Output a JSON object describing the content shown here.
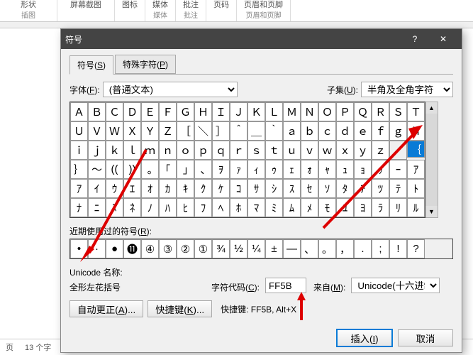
{
  "ribbon": [
    "形状",
    "屏幕截图",
    "图标",
    "媒体",
    "批注",
    "页码",
    "页眉和页脚"
  ],
  "ribbonGroups": [
    "插图",
    "",
    "",
    "媒体",
    "批注",
    "页眉和页脚"
  ],
  "status": {
    "page": "页",
    "words": "13 个字",
    "lang": ""
  },
  "dialog": {
    "title": "符号",
    "tabs": {
      "sym_pre": "符号(",
      "sym_u": "S",
      "sym_post": ")",
      "spec_pre": "特殊字符(",
      "spec_u": "P",
      "spec_post": ")"
    },
    "fontLabel_pre": "字体(",
    "fontLabel_u": "F",
    "fontLabel_post": "):",
    "fontValue": "(普通文本)",
    "subsetLabel_pre": "子集(",
    "subsetLabel_u": "U",
    "subsetLabel_post": "):",
    "subsetValue": "半角及全角字符",
    "grid": [
      [
        "Ａ",
        "Ｂ",
        "Ｃ",
        "Ｄ",
        "Ｅ",
        "Ｆ",
        "Ｇ",
        "Ｈ",
        "Ｉ",
        "Ｊ",
        "Ｋ",
        "Ｌ",
        "Ｍ",
        "Ｎ",
        "Ｏ",
        "Ｐ",
        "Ｑ",
        "Ｒ",
        "Ｓ",
        "Ｔ"
      ],
      [
        "Ｕ",
        "Ｖ",
        "Ｗ",
        "Ｘ",
        "Ｙ",
        "Ｚ",
        "［",
        "＼",
        "］",
        "＾",
        "＿",
        "｀",
        "ａ",
        "ｂ",
        "ｃ",
        "ｄ",
        "ｅ",
        "ｆ",
        "ｇ",
        "ｈ"
      ],
      [
        "ｉ",
        "ｊ",
        "ｋ",
        "ｌ",
        "ｍ",
        "ｎ",
        "ｏ",
        "ｐ",
        "ｑ",
        "ｒ",
        "ｓ",
        "ｔ",
        "ｕ",
        "ｖ",
        "ｗ",
        "ｘ",
        "ｙ",
        "ｚ",
        "",
        "｛"
      ],
      [
        "｝",
        "～",
        "((",
        "))",
        "｡",
        "｢",
        "｣",
        "､",
        "ｦ",
        "ｧ",
        "ｨ",
        "ｩ",
        "ｪ",
        "ｫ",
        "ｬ",
        "ｭ",
        "ｮ",
        "ｯ",
        "ｰ",
        "ｱ"
      ],
      [
        "ｱ",
        "ｲ",
        "ｳ",
        "ｴ",
        "ｵ",
        "ｶ",
        "ｷ",
        "ｸ",
        "ｹ",
        "ｺ",
        "ｻ",
        "ｼ",
        "ｽ",
        "ｾ",
        "ｿ",
        "ﾀ",
        "ﾁ",
        "ﾂ",
        "ﾃ",
        "ﾄ"
      ],
      [
        "ﾅ",
        "ﾆ",
        "ﾇ",
        "ﾈ",
        "ﾉ",
        "ﾊ",
        "ﾋ",
        "ﾌ",
        "ﾍ",
        "ﾎ",
        "ﾏ",
        "ﾐ",
        "ﾑ",
        "ﾒ",
        "ﾓ",
        "ﾕ",
        "ﾖ",
        "ﾗ",
        "ﾘ",
        "ﾙ"
      ]
    ],
    "selected": {
      "row": 2,
      "col": 19
    },
    "emptyCell": {
      "row": 2,
      "col": 18
    },
    "recentLabel_pre": "近期使用过的符号(",
    "recentLabel_u": "R",
    "recentLabel_post": "):",
    "recent": [
      "•",
      "·",
      "●",
      "⓫",
      "④",
      "③",
      "②",
      "①",
      "¾",
      "½",
      "¼",
      "±",
      "—",
      "、",
      "。",
      "，",
      ".",
      ";",
      "!",
      "?"
    ],
    "unicodeNameLabel": "Unicode 名称:",
    "unicodeName": "全形左花括号",
    "codeLabel_pre": "字符代码(",
    "codeLabel_u": "C",
    "codeLabel_post": "):",
    "codeValue": "FF5B",
    "fromLabel_pre": "来自(",
    "fromLabel_u": "M",
    "fromLabel_post": "):",
    "fromValue": "Unicode(十六进制)",
    "autocorrect_pre": "自动更正(",
    "autocorrect_u": "A",
    "autocorrect_post": ")...",
    "shortcut_pre": "快捷键(",
    "shortcut_u": "K",
    "shortcut_post": ")...",
    "shortcutText": "快捷键: FF5B, Alt+X",
    "insert_pre": "插入(",
    "insert_u": "I",
    "insert_post": ")",
    "cancel": "取消"
  }
}
